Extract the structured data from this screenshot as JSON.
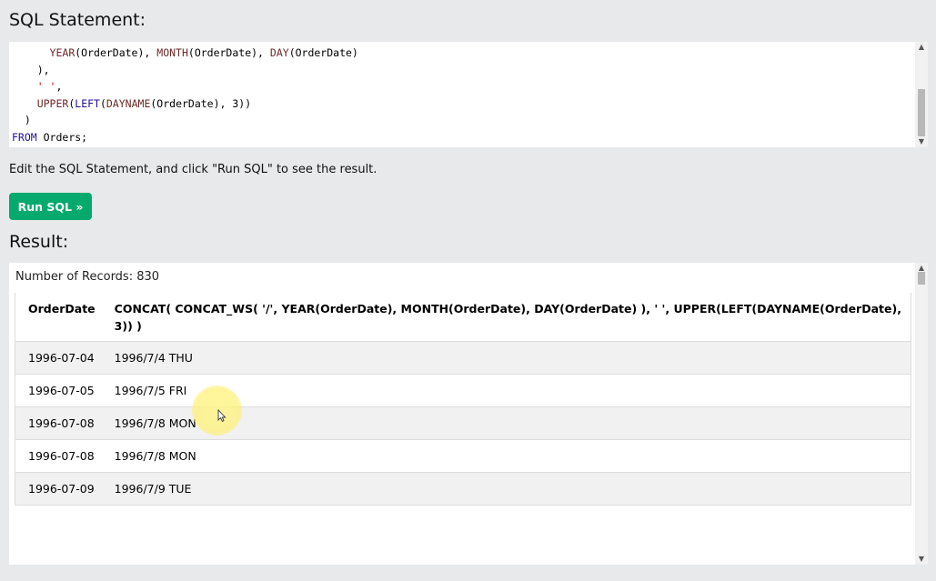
{
  "headings": {
    "sql": "SQL Statement:",
    "result": "Result:"
  },
  "editor": {
    "lines": [
      [
        "      ",
        "YEAR",
        "(OrderDate), ",
        "MONTH",
        "(OrderDate), ",
        "DAY",
        "(OrderDate)"
      ],
      [
        "    ),"
      ],
      [
        "    ",
        "' '",
        ","
      ],
      [
        "    ",
        "UPPER",
        "(",
        "LEFT",
        "(",
        "DAYNAME",
        "(OrderDate), 3))"
      ],
      [
        "  )"
      ],
      [
        "FROM",
        " Orders;"
      ]
    ],
    "line1": {
      "ind": "      ",
      "f1": "YEAR",
      "a1": "(OrderDate), ",
      "f2": "MONTH",
      "a2": "(OrderDate), ",
      "f3": "DAY",
      "a3": "(OrderDate)"
    },
    "line2": "    ),",
    "line3": {
      "ind": "    ",
      "str": "' '",
      "rest": ","
    },
    "line4": {
      "ind": "    ",
      "f1": "UPPER",
      "p1": "(",
      "f2": "LEFT",
      "p2": "(",
      "f3": "DAYNAME",
      "rest": "(OrderDate), 3))"
    },
    "line5": "  )",
    "line6": {
      "kw": "FROM",
      "rest": " Orders;"
    }
  },
  "help_text": "Edit the SQL Statement, and click \"Run SQL\" to see the result.",
  "run_button": "Run SQL »",
  "result": {
    "records": "Number of Records: 830",
    "columns": {
      "c1": "OrderDate",
      "c2": "CONCAT( CONCAT_WS( '/', YEAR(OrderDate), MONTH(OrderDate), DAY(OrderDate) ), ' ', UPPER(LEFT(DAYNAME(OrderDate), 3)) )"
    },
    "rows": [
      {
        "date": "1996-07-04",
        "value": "1996/7/4 THU"
      },
      {
        "date": "1996-07-05",
        "value": "1996/7/5 FRI"
      },
      {
        "date": "1996-07-08",
        "value": "1996/7/8 MON"
      },
      {
        "date": "1996-07-08",
        "value": "1996/7/8 MON"
      },
      {
        "date": "1996-07-09",
        "value": "1996/7/9 TUE"
      }
    ]
  },
  "icons": {
    "scroll_up": "scroll-up-arrow-icon",
    "scroll_down": "scroll-down-arrow-icon",
    "cursor": "mouse-pointer-icon"
  },
  "colors": {
    "background": "#e7e9eb",
    "button": "#04aa6d",
    "keyword": "#770088",
    "string": "#aa1111"
  }
}
